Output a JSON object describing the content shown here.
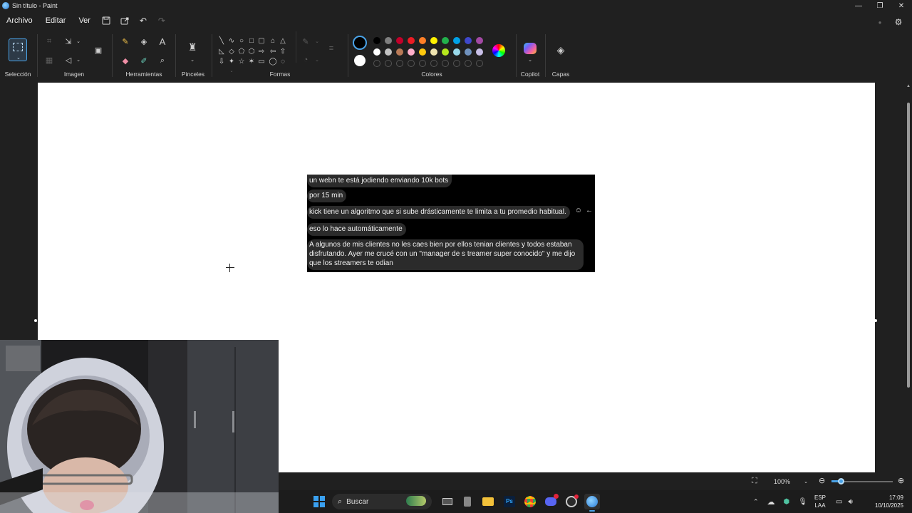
{
  "window": {
    "title": "Sin título - Paint",
    "controls": {
      "minimize": "—",
      "maximize": "❐",
      "close": "✕"
    }
  },
  "menu": {
    "items": [
      "Archivo",
      "Editar",
      "Ver"
    ],
    "icons": [
      "save-icon",
      "share-icon",
      "undo-icon",
      "redo-icon"
    ]
  },
  "ribbon": {
    "groups": {
      "seleccion": "Selección",
      "imagen": "Imagen",
      "herramientas": "Herramientas",
      "pinceles": "Pinceles",
      "formas": "Formas",
      "colores": "Colores",
      "copilot": "Copilot",
      "capas": "Capas"
    },
    "colors": {
      "primary": "#000000",
      "secondary": "#ffffff",
      "row1": [
        "#000000",
        "#7f7f7f",
        "#c3002a",
        "#ed1c24",
        "#ff7f27",
        "#fff200",
        "#22b14c",
        "#00a2e8",
        "#3f48cc",
        "#a349a4"
      ],
      "row2": [
        "#ffffff",
        "#c3c3c3",
        "#b97a57",
        "#ffaec9",
        "#ffc90e",
        "#efe4b0",
        "#b5e61d",
        "#99d9ea",
        "#7092be",
        "#c8bfe7"
      ]
    }
  },
  "chat": {
    "messages": [
      "un webn te está jodiendo enviando 10k bots",
      "por 15 min",
      "kick tiene un algoritmo que si sube drásticamente te limita a tu promedio habitual.",
      "eso lo hace automáticamente",
      "A algunos de mis clientes no les caes bien por ellos tenian clientes y todos estaban",
      "disfrutando. Ayer me crucé con un \"manager de s treamer super conocido\" y me dijo",
      "que los streamers te odian"
    ]
  },
  "status": {
    "zoom": "100%",
    "zoom_level": 1.0
  },
  "taskbar": {
    "search_placeholder": "Buscar",
    "language": "ESP",
    "language_sub": "LAA",
    "time": "17:09",
    "date": "10/10/2025",
    "apps": [
      "windows-start-icon",
      "search-icon",
      "widgets-icon",
      "file-explorer-icon",
      "folder-icon",
      "photoshop-icon",
      "chrome-icon",
      "discord-icon",
      "obs-icon",
      "paint-icon"
    ]
  }
}
